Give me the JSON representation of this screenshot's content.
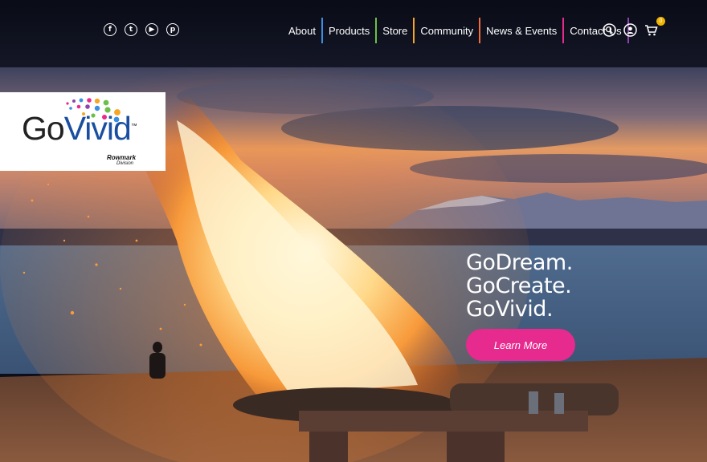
{
  "social": [
    {
      "icon": "facebook-icon",
      "glyph": "f"
    },
    {
      "icon": "twitter-icon",
      "glyph": "t"
    },
    {
      "icon": "youtube-icon",
      "glyph": "▶"
    },
    {
      "icon": "pinterest-icon",
      "glyph": "p"
    }
  ],
  "nav": {
    "items": [
      {
        "label": "About",
        "color": "#3b8fe0"
      },
      {
        "label": "Products",
        "color": "#6cc04a"
      },
      {
        "label": "Store",
        "color": "#f5a623"
      },
      {
        "label": "Community",
        "color": "#f26b3a"
      },
      {
        "label": "News & Events",
        "color": "#e62a8e"
      },
      {
        "label": "Contact Us",
        "color": "#8e44ad"
      }
    ]
  },
  "utility": {
    "search_icon": "search-icon",
    "account_icon": "user-icon",
    "cart_icon": "cart-icon",
    "cart_count": "0"
  },
  "logo": {
    "go": "Go",
    "vivid": "Vivid",
    "trademark": "™",
    "division_brand": "Rowmark",
    "division_label": "Division"
  },
  "hero": {
    "tagline": [
      "GoDream.",
      "GoCreate.",
      "GoVivid."
    ],
    "cta_label": "Learn More",
    "cta_color": "#e62a8e"
  }
}
